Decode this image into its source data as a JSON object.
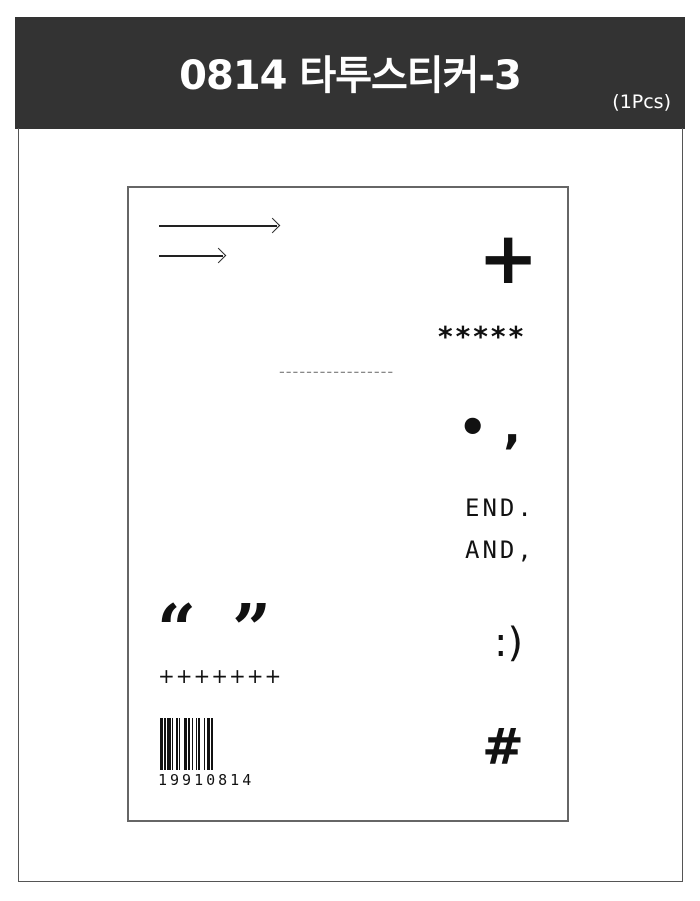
{
  "header": {
    "title": "0814 타투스티커-3",
    "quantity": "(1Pcs)"
  },
  "sticker": {
    "plus": "+",
    "stars": "*****",
    "dashes": "-----------------",
    "dot_comma": "• ,",
    "end": "END.",
    "and": "AND,",
    "open_quote": "“",
    "close_quote": "”",
    "smiley": ":)",
    "plus_row": "+++++++",
    "hash": "#",
    "barcode_number": "19910814"
  },
  "colors": {
    "header_bg": "#333333",
    "ink": "#111111"
  }
}
